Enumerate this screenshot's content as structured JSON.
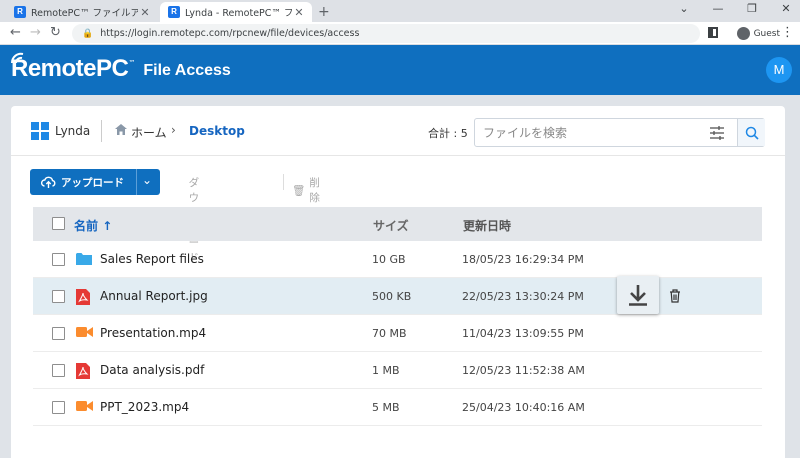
{
  "browser": {
    "tabs": [
      {
        "title": "RemotePC™ ファイルアクセス",
        "active": false
      },
      {
        "title": "Lynda  - RemotePC™ ファイル",
        "active": true
      }
    ],
    "favicon_letter": "R",
    "new_tab": "+",
    "url": "https://login.remotepc.com/rpcnew/file/devices/access",
    "profile_label": "Guest",
    "window_controls": [
      "⌄",
      "—",
      "❐",
      "✕"
    ]
  },
  "app": {
    "brand": "RemotePC",
    "product": "File Access",
    "avatar_initial": "M",
    "header_color": "#0f6fbf"
  },
  "breadcrumb": {
    "device": "Lynda",
    "home": "ホーム",
    "separator": "›",
    "current": "Desktop"
  },
  "total_label": "合計 : 5",
  "search": {
    "placeholder": "ファイルを検索"
  },
  "actions": {
    "upload": "アップロード",
    "download": "ダウンロード",
    "delete": "削除"
  },
  "table": {
    "columns": {
      "name": "名前",
      "sort_arrow": "↑",
      "size": "サイズ",
      "modified": "更新日時"
    },
    "rows": [
      {
        "name": "Sales Report files",
        "size": "10 GB",
        "modified": "18/05/23 16:29:34 PM",
        "icon": "folder-icon",
        "icon_color": "#39a9e8"
      },
      {
        "name": "Annual Report.jpg",
        "size": "500 KB",
        "modified": "22/05/23 13:30:24 PM",
        "icon": "pdf-icon",
        "icon_color": "#e53935",
        "hovered": true
      },
      {
        "name": "Presentation.mp4",
        "size": "70 MB",
        "modified": "11/04/23 13:09:55 PM",
        "icon": "video-icon",
        "icon_color": "#fb8c2e"
      },
      {
        "name": "Data analysis.pdf",
        "size": "1 MB",
        "modified": "12/05/23 11:52:38 AM",
        "icon": "pdf-icon",
        "icon_color": "#e53935"
      },
      {
        "name": "PPT_2023.mp4",
        "size": "5 MB",
        "modified": "25/04/23 10:40:16 AM",
        "icon": "video-icon",
        "icon_color": "#fb8c2e"
      }
    ]
  }
}
